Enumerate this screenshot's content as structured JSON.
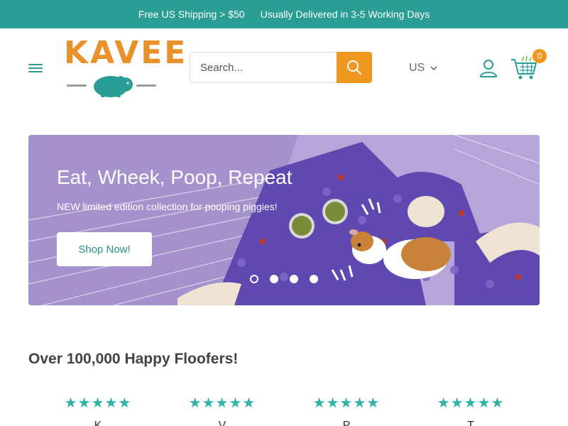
{
  "announcement": {
    "shipping": "Free US Shipping > $50",
    "delivery": "Usually Delivered in 3-5 Working Days"
  },
  "header": {
    "logo_text": "KAVEE",
    "search_placeholder": "Search...",
    "country": "US",
    "cart_count": "0"
  },
  "hero": {
    "title": "Eat, Wheek, Poop, Repeat",
    "subtitle": "NEW limited edition collection for pooping piggies!",
    "button": "Shop Now!",
    "slide_count": 4,
    "active_slide": 1
  },
  "reviews": {
    "title": "Over 100,000 Happy Floofers!",
    "items": [
      {
        "stars": "★★★★★",
        "name": "K"
      },
      {
        "stars": "★★★★★",
        "name": "V"
      },
      {
        "stars": "★★★★★",
        "name": "P"
      },
      {
        "stars": "★★★★★",
        "name": "T"
      }
    ]
  },
  "colors": {
    "brand_teal": "#2a9d94",
    "brand_orange": "#f09720",
    "hero_purple": "#a592cc"
  }
}
